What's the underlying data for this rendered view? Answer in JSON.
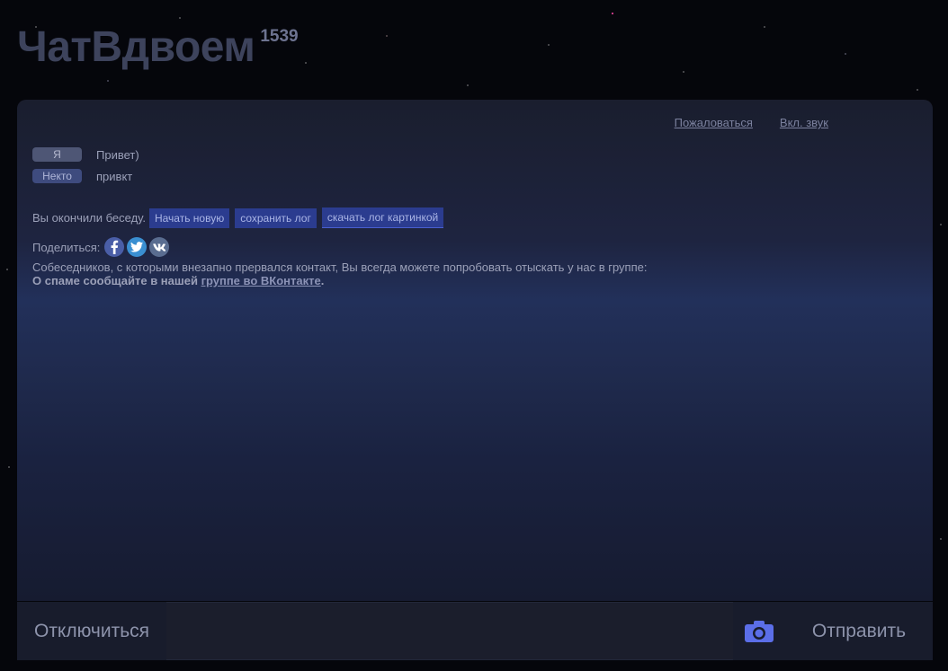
{
  "header": {
    "title": "ЧатВдвоем",
    "online_count": "1539"
  },
  "top_links": {
    "report": "Пожаловаться",
    "sound": "Вкл. звук"
  },
  "messages": [
    {
      "author": "Я",
      "text": "Привет)"
    },
    {
      "author": "Некто",
      "text": "привкт"
    }
  ],
  "chat_end": {
    "text": "Вы окончили беседу.",
    "buttons": {
      "new_chat": "Начать новую",
      "save_log": "сохранить лог",
      "download_image": "скачать лог картинкой"
    }
  },
  "share": {
    "label": "Поделиться:",
    "icons": [
      "facebook-icon",
      "twitter-icon",
      "vk-icon"
    ]
  },
  "info": {
    "text": "Собеседников, с которыми внезапно прервался контакт, Вы всегда можете попробовать отыскать у нас в группе:",
    "spam_prefix": "О спаме сообщайте в нашей ",
    "spam_link": "группе во ВКонтакте",
    "spam_suffix": "."
  },
  "bottom_bar": {
    "disconnect": "Отключиться",
    "input_value": "",
    "input_placeholder": "",
    "send": "Отправить",
    "camera_icon": "camera-icon"
  },
  "colors": {
    "background": "#05060b",
    "panel": "#1e2440",
    "button": "#2b3c8f",
    "camera": "#5b6ee8"
  }
}
